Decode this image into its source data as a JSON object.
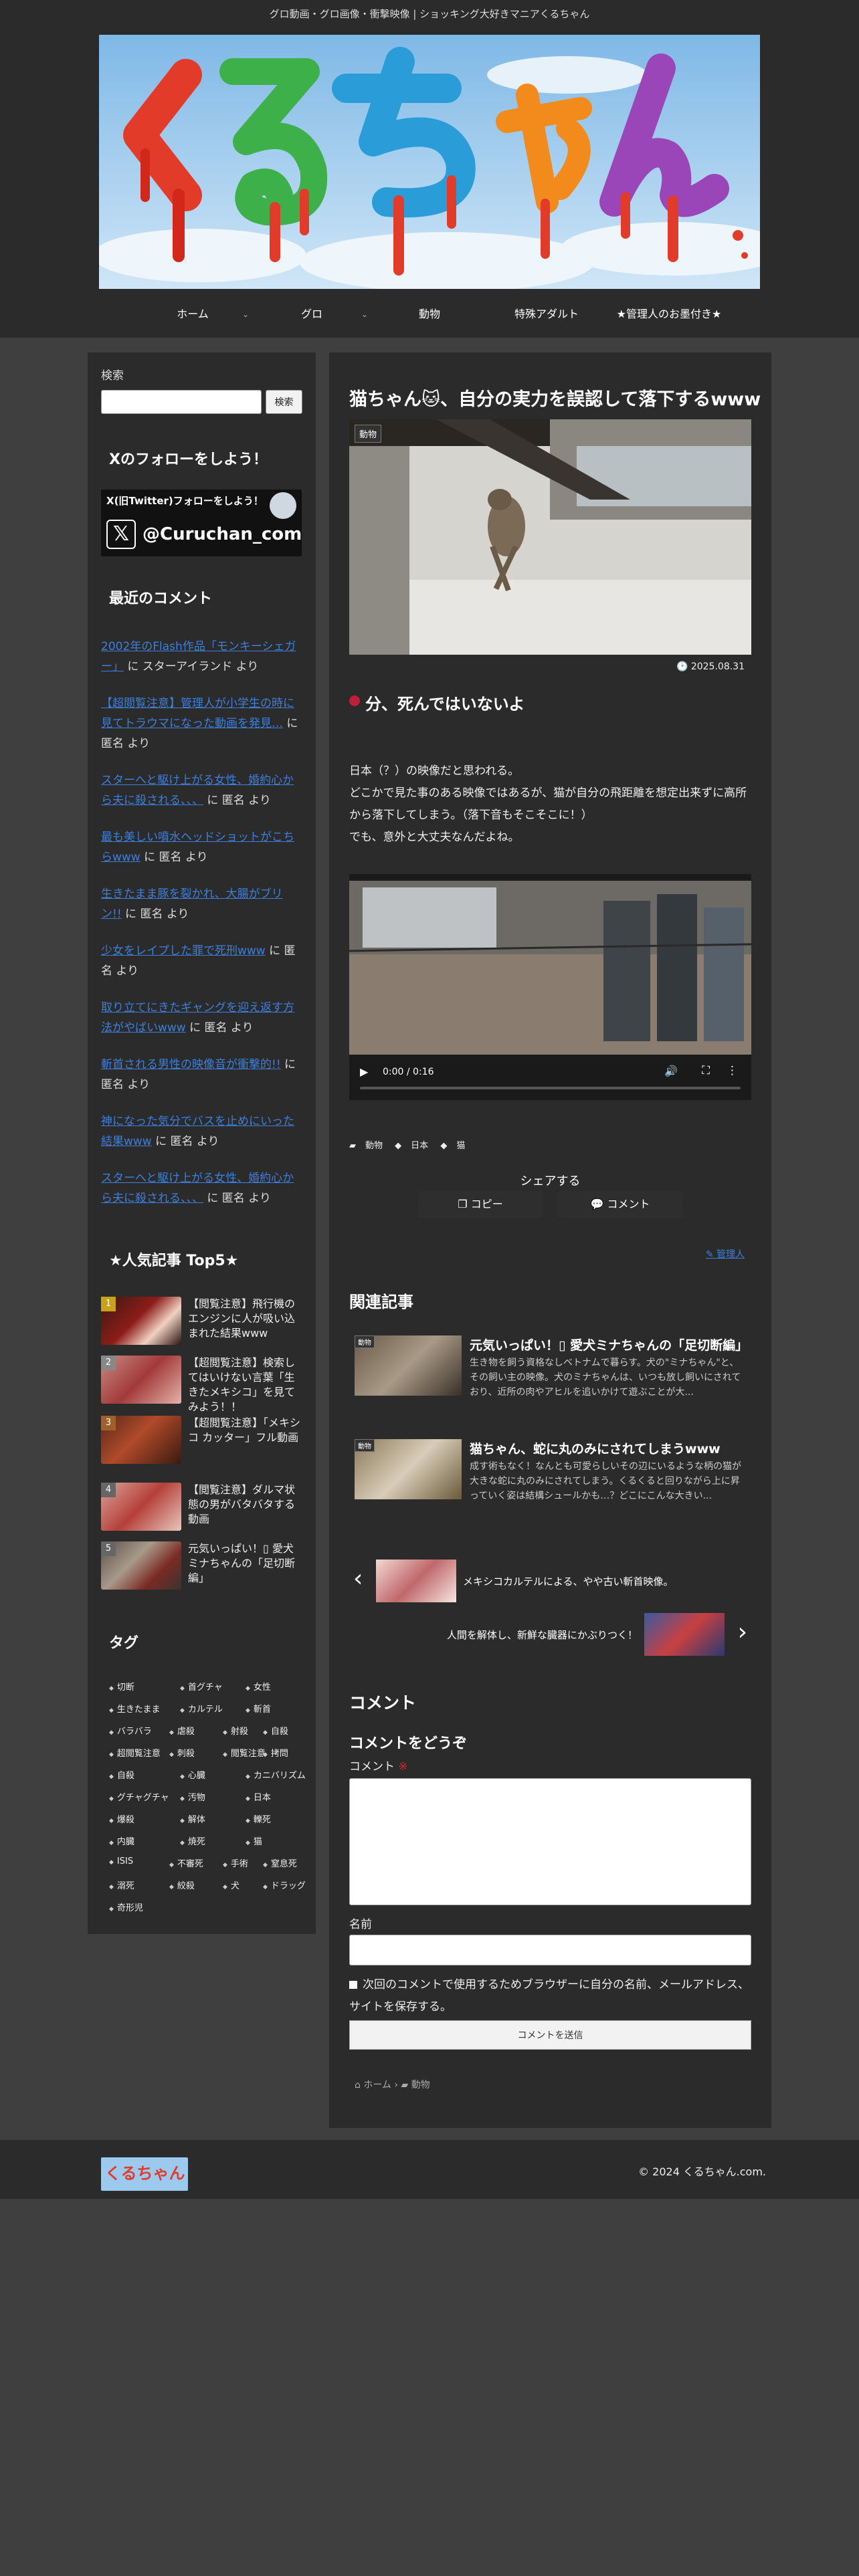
{
  "header": {
    "tagline": "グロ動画・グロ画像・衝撃映像 | ショッキング大好きマニアくるちゃん",
    "logo_text": "くるちゃん",
    "nav": [
      "ホーム",
      "グロ",
      "動物",
      "特殊アダルト",
      "★管理人のお墨付き★"
    ]
  },
  "sidebar": {
    "search_label": "検索",
    "search_button": "検索",
    "x_heading": "Xのフォローをしよう！",
    "x_banner_line1": "X(旧Twitter)フォローをしよう！",
    "x_banner_handle": "@Curuchan_com",
    "recent_heading": "最近のコメント",
    "comments": [
      {
        "link": "2002年のFlash作品「モンキーシェガー」",
        "by": " に スターアイランド より"
      },
      {
        "link": "【超閲覧注意】管理人が小学生の時に見てトラウマになった動画を発見…",
        "by": " に 匿名 より"
      },
      {
        "link": "スターへと駆け上がる女性、婚約心から夫に殺される、、、",
        "by": " に 匿名 より"
      },
      {
        "link": "最も美しい噴水ヘッドショットがこちらwww",
        "by": " に 匿名 より"
      },
      {
        "link": "生きたまま豚を裂かれ、大腸がブリン!!",
        "by": " に 匿名 より"
      },
      {
        "link": "少女をレイプした罪で死刑www",
        "by": " に 匿名 より"
      },
      {
        "link": "取り立てにきたギャングを迎え返す方法がやばいwww",
        "by": " に 匿名 より"
      },
      {
        "link": "斬首される男性の映像音が衝撃的!!",
        "by": " に 匿名 より"
      },
      {
        "link": "神になった気分でバスを止めにいった結果www",
        "by": " に 匿名 より"
      },
      {
        "link": "スターへと駆け上がる女性、婚約心から夫に殺される、、、",
        "by": " に 匿名 より"
      }
    ],
    "popular_heading": "★人気記事 Top5★",
    "popular": [
      {
        "num": "1",
        "title": "【閲覧注意】飛行機のエンジンに人が吸い込まれた結果www"
      },
      {
        "num": "2",
        "title": "【超閲覧注意】検索してはいけない言葉「生きたメキシコ」を見てみよう！！"
      },
      {
        "num": "3",
        "title": "【超閲覧注意】「メキシコ カッター」フル動画"
      },
      {
        "num": "4",
        "title": "【閲覧注意】ダルマ状態の男がバタバタする動画"
      },
      {
        "num": "5",
        "title": "元気いっぱい！▯ 愛犬ミナちゃんの「足切断編」"
      }
    ],
    "tags_heading": "タグ",
    "tags": [
      "切断",
      "首グチャ",
      "女性",
      "生きたまま",
      "カルテル",
      "斬首",
      "バラバラ",
      "虐殺",
      "射殺",
      "自殺",
      "超閲覧注意",
      "刺殺",
      "閲覧注意",
      "拷問",
      "自殺",
      "心臓",
      "カニバリズム",
      "グチャグチャ",
      "汚物",
      "日本",
      "爆殺",
      "解体",
      "轢死",
      "内臓",
      "焼死",
      "猫",
      "ISIS",
      "不審死",
      "手術",
      "窒息死",
      "溺死",
      "絞殺",
      "犬",
      "ドラッグ",
      "奇形児"
    ]
  },
  "article": {
    "title": "猫ちゃん🐱、自分の実力を誤認して落下するwww",
    "category": "動物",
    "date": "2025.08.31",
    "subheading": "分、死んではいないよ",
    "body": [
      "日本（？）の映像だと思われる。",
      "どこかで見た事のある映像ではあるが、猫が自分の飛距離を想定出来ずに高所から落下してしまう。（落下音もそこそこに！）",
      "でも、意外と大丈夫なんだよね。"
    ],
    "video_time": "0:00 / 0:16",
    "video_progress": 0.0,
    "tags": [
      "動物",
      "日本",
      "猫"
    ],
    "share_label": "シェアする",
    "copy_label": "コピー",
    "comment_btn_label": "コメント",
    "author": "管理人"
  },
  "related": {
    "heading": "関連記事",
    "items": [
      {
        "badge": "動物",
        "title": "元気いっぱい！▯ 愛犬ミナちゃんの「足切断編」",
        "snippet": "生き物を飼う資格なしベトナムで暮らす。犬の\"ミナちゃん\"と、その飼い主の映像。犬のミナちゃんは、いつも放し飼いにされており、近所の肉やアヒルを追いかけて遊ぶことが大..."
      },
      {
        "badge": "動物",
        "title": "猫ちゃん、蛇に丸のみにされてしまうwww",
        "snippet": "成す術もなく！なんとも可愛らしいその辺にいるような柄の猫が大きな蛇に丸のみにされてしまう。くるくると回りながら上に昇っていく姿は結構シュールかも…？どこにこんな大きい..."
      }
    ]
  },
  "prevnext": {
    "prev": "メキシコカルテルによる、やや古い斬首映像。",
    "next": "人間を解体し、新鮮な臓器にかぶりつく！"
  },
  "comment_form": {
    "heading": "コメント",
    "subheading": "コメントをどうぞ",
    "comment_label": "コメント",
    "required_mark": "※",
    "name_label": "名前",
    "save_info": "次回のコメントで使用するためブラウザーに自分の名前、メールアドレス、サイトを保存する。",
    "submit": "コメントを送信"
  },
  "breadcrumb": {
    "home": "ホーム",
    "category": "動物"
  },
  "footer": {
    "copyright": "© 2024 くるちゃん.com."
  }
}
